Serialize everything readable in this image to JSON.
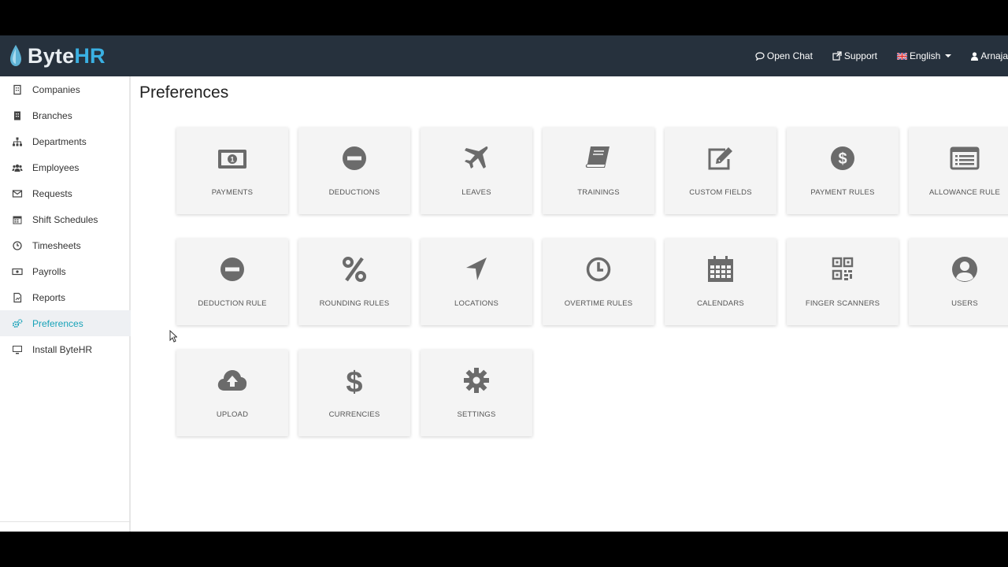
{
  "brand": {
    "part_a": "Byte",
    "part_b": "HR",
    "accent": "#3ab0e2"
  },
  "topnav": {
    "open_chat": "Open Chat",
    "support": "Support",
    "language": "English",
    "user": "Arnaja"
  },
  "sidebar": {
    "items": [
      {
        "label": "Companies",
        "icon": "building-icon"
      },
      {
        "label": "Branches",
        "icon": "branch-icon"
      },
      {
        "label": "Departments",
        "icon": "sitemap-icon"
      },
      {
        "label": "Employees",
        "icon": "users-icon"
      },
      {
        "label": "Requests",
        "icon": "envelope-icon"
      },
      {
        "label": "Shift Schedules",
        "icon": "calendar-icon"
      },
      {
        "label": "Timesheets",
        "icon": "clock-icon"
      },
      {
        "label": "Payrolls",
        "icon": "money-icon"
      },
      {
        "label": "Reports",
        "icon": "report-icon"
      },
      {
        "label": "Preferences",
        "icon": "cogs-icon",
        "active": true
      },
      {
        "label": "Install ByteHR",
        "icon": "desktop-icon"
      }
    ]
  },
  "main": {
    "title": "Preferences",
    "tiles": [
      {
        "label": "PAYMENTS",
        "icon": "money-bill-icon"
      },
      {
        "label": "DEDUCTIONS",
        "icon": "minus-circle-icon"
      },
      {
        "label": "LEAVES",
        "icon": "plane-icon"
      },
      {
        "label": "TRAININGS",
        "icon": "book-icon"
      },
      {
        "label": "CUSTOM FIELDS",
        "icon": "edit-icon"
      },
      {
        "label": "PAYMENT RULES",
        "icon": "dollar-circle-icon"
      },
      {
        "label": "ALLOWANCE RULE",
        "icon": "list-icon"
      },
      {
        "label": "DEDUCTION RULE",
        "icon": "minus-circle-icon"
      },
      {
        "label": "ROUNDING RULES",
        "icon": "percent-icon"
      },
      {
        "label": "LOCATIONS",
        "icon": "location-arrow-icon"
      },
      {
        "label": "OVERTIME RULES",
        "icon": "clock-icon"
      },
      {
        "label": "CALENDARS",
        "icon": "calendar-icon"
      },
      {
        "label": "FINGER SCANNERS",
        "icon": "qrcode-icon"
      },
      {
        "label": "USERS",
        "icon": "user-circle-icon"
      },
      {
        "label": "UPLOAD",
        "icon": "cloud-upload-icon"
      },
      {
        "label": "CURRENCIES",
        "icon": "dollar-icon"
      },
      {
        "label": "SETTINGS",
        "icon": "cog-icon"
      }
    ]
  },
  "colors": {
    "topbar": "#26313d",
    "tile_bg": "#f4f4f4",
    "icon": "#6b6b6b",
    "active": "#17a2b8"
  }
}
